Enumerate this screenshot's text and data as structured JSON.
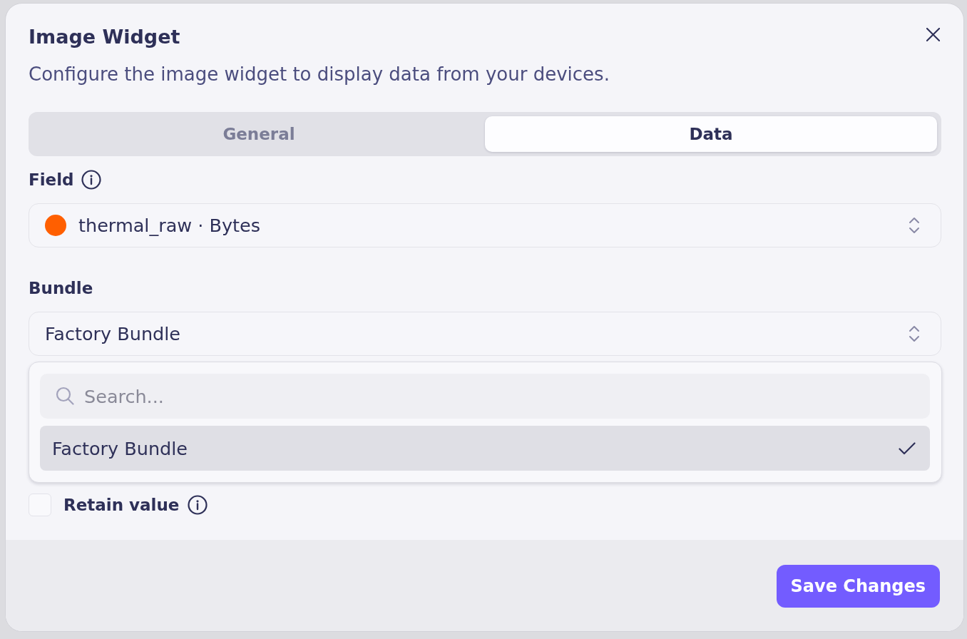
{
  "dialog": {
    "title": "Image Widget",
    "description": "Configure the image widget to display data from your devices."
  },
  "tabs": [
    {
      "label": "General",
      "selected": false
    },
    {
      "label": "Data",
      "selected": true
    }
  ],
  "field": {
    "label": "Field",
    "value": "thermal_raw · Bytes",
    "color": "#ff5f00"
  },
  "bundle": {
    "label": "Bundle",
    "value": "Factory Bundle",
    "expanded": true,
    "search": {
      "placeholder": "Search..."
    },
    "options": [
      {
        "label": "Factory Bundle",
        "selected": true
      }
    ]
  },
  "retain_value": {
    "label": "Retain value",
    "checked": false
  },
  "buttons": [
    {
      "label": "Save Changes"
    }
  ]
}
